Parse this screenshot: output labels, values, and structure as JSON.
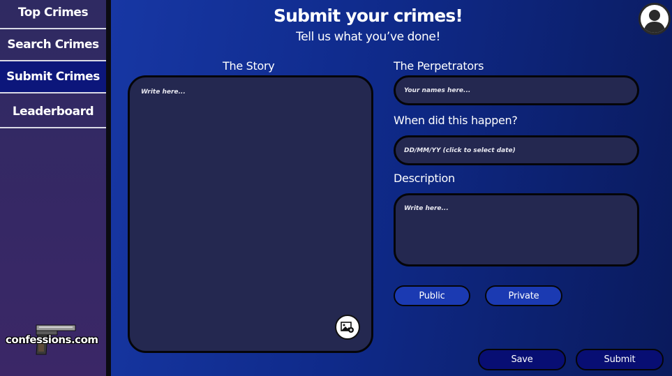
{
  "sidebar": {
    "items": [
      {
        "label": "Top Crimes",
        "active": false
      },
      {
        "label": "Search Crimes",
        "active": false
      },
      {
        "label": "Submit Crimes",
        "active": true
      },
      {
        "label": "Leaderboard",
        "active": false
      }
    ],
    "logo_text": "confessions.com"
  },
  "header": {
    "title": "Submit your crimes!",
    "subtitle": "Tell us what you’ve done!"
  },
  "story": {
    "label": "The Story",
    "placeholder": "Write here..."
  },
  "perpetrators": {
    "label": "The Perpetrators",
    "placeholder": "Your names here..."
  },
  "date": {
    "label": "When did this happen?",
    "placeholder": "DD/MM/YY (click to select date)"
  },
  "description": {
    "label": "Description",
    "placeholder": "Write here..."
  },
  "visibility": {
    "public_label": "Public",
    "private_label": "Private"
  },
  "actions": {
    "save_label": "Save",
    "submit_label": "Submit"
  },
  "colors": {
    "sidebar_bg": "#2f2a62",
    "active_nav_bg": "#0c167b",
    "main_bg": "#1737a4",
    "field_bg": "#242850",
    "pill_bg": "#1b3ab2",
    "action_bg": "#080e73"
  },
  "icons": {
    "avatar": "user-avatar-icon",
    "upload": "image-upload-icon",
    "logo": "pistol-icon"
  }
}
